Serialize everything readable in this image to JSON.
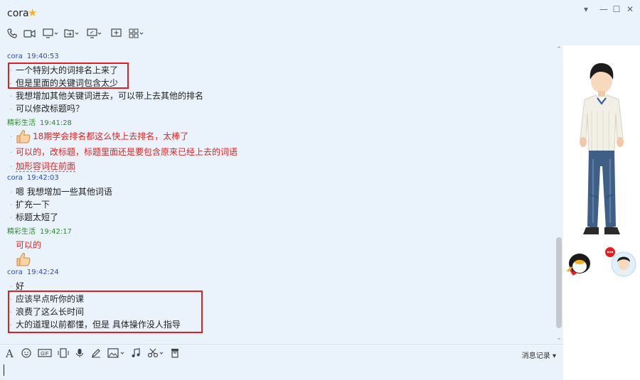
{
  "window": {
    "title": "cora",
    "controls": [
      "chevron-down",
      "minimize",
      "maximize",
      "close"
    ]
  },
  "toolbar": {
    "icons": [
      "phone-icon",
      "video-call-icon",
      "screen-share-icon",
      "file-transfer-icon",
      "remote-desktop-icon",
      "whiteboard-icon",
      "apps-grid-icon"
    ]
  },
  "chat": {
    "messages": [
      {
        "sender": "cora",
        "time": "19:40:53",
        "lines": [
          {
            "text": "一个特别大的词排名上来了"
          },
          {
            "text": "但是里面的关键词包含太少"
          },
          {
            "text": "我想增加其他关键词进去，可以带上去其他的排名"
          },
          {
            "text": "可以修改标题吗？"
          }
        ]
      },
      {
        "sender": "精彩生活",
        "time": "19:41:28",
        "lines": [
          {
            "text": "18期学会排名都这么快上去排名，太棒了",
            "emoji": "thumbs-up"
          },
          {
            "text": "可以的，改标题，标题里面还是要包含原来已经上去的词语"
          },
          {
            "text": "加形容词在前面"
          }
        ]
      },
      {
        "sender": "cora",
        "time": "19:42:03",
        "lines": [
          {
            "text": "嗯  我想增加一些其他词语"
          },
          {
            "text": "扩充一下"
          },
          {
            "text": "标题太短了"
          }
        ]
      },
      {
        "sender": "精彩生活",
        "time": "19:42:17",
        "lines": [
          {
            "text": "可以的"
          },
          {
            "text": "",
            "emoji": "thumbs-up"
          }
        ]
      },
      {
        "sender": "cora",
        "time": "19:42:24",
        "lines": [
          {
            "text": "好"
          },
          {
            "text": "应该早点听你的课"
          },
          {
            "text": "浪费了这么长时间"
          },
          {
            "text": "大的道理以前都懂，但是  具体操作没人指导"
          }
        ]
      }
    ]
  },
  "input_toolbar": {
    "icons": [
      "font-icon",
      "emoji-icon",
      "gif-icon",
      "shake-icon",
      "voice-icon",
      "draw-icon",
      "image-icon",
      "music-icon",
      "screenshot-icon",
      "trash-icon"
    ],
    "history_label": "消息记录"
  },
  "colors": {
    "background": "#eaf3fb",
    "cora": "#2b49c6",
    "partner": "#2b8a2b",
    "partner_text": "#e2221f",
    "highlight_box": "#e02020"
  }
}
